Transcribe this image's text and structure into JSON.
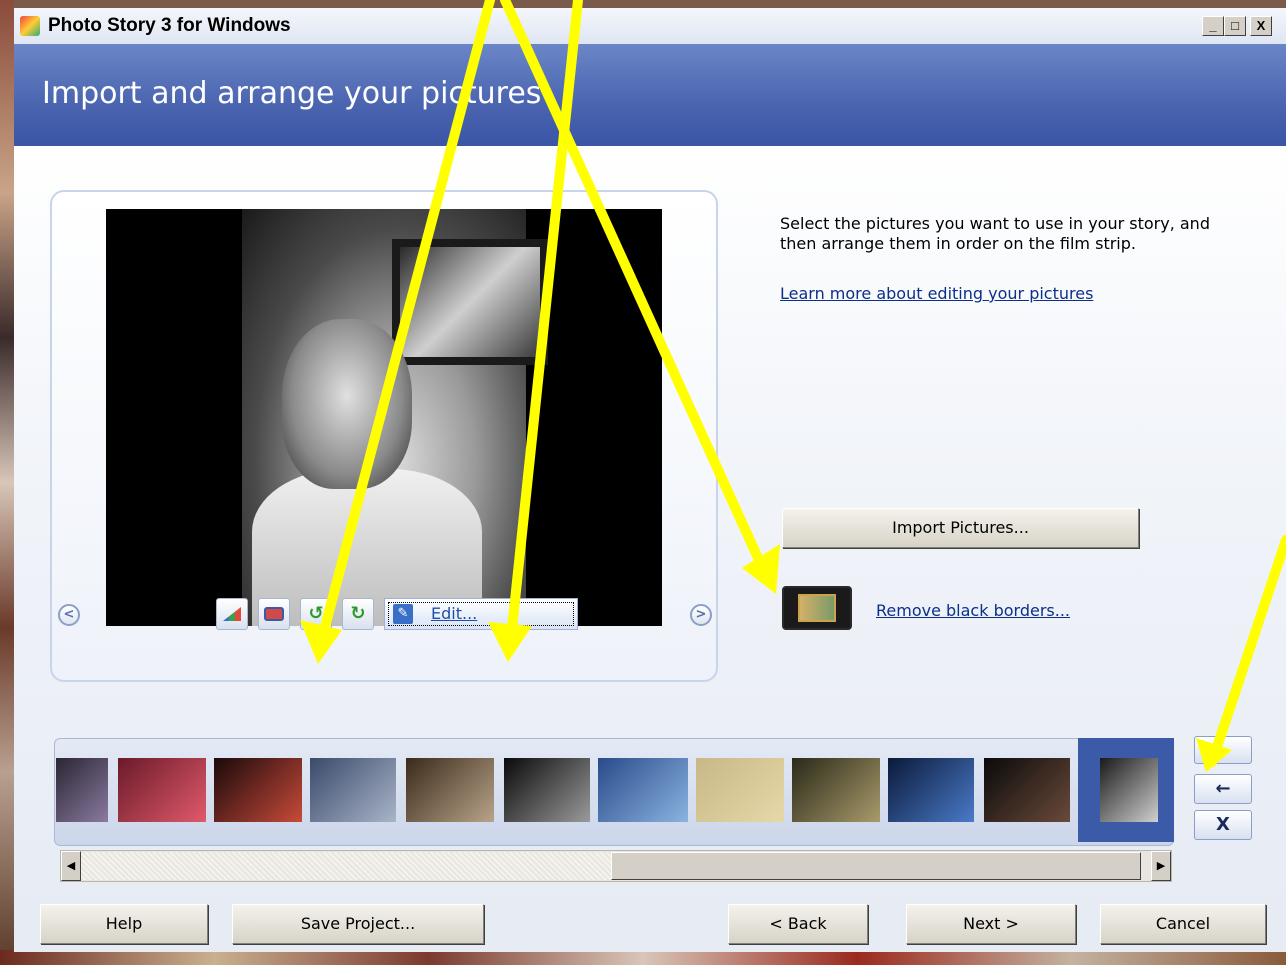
{
  "window": {
    "title": "Photo Story 3 for Windows",
    "min_label": "_",
    "max_label": "□",
    "close_label": "X"
  },
  "header": {
    "title": "Import and arrange your pictures"
  },
  "preview": {
    "prev_label": "<",
    "next_label": ">",
    "tools": {
      "auto_correct_icon": "levels-icon",
      "red_eye_icon": "red-eye-icon",
      "rotate_left_icon": "rotate-left-icon",
      "rotate_right_icon": "rotate-right-icon"
    },
    "edit_label": "Edit..."
  },
  "instructions": {
    "text": "Select the pictures you want to use in your story, and then arrange them in order on the film strip.",
    "learn_link": "Learn more about editing your pictures"
  },
  "actions": {
    "import_label": "Import Pictures...",
    "remove_borders_label": "Remove black borders..."
  },
  "filmstrip": {
    "thumbnails": [
      {
        "colors": [
          "#2a2633",
          "#8a7aa0"
        ]
      },
      {
        "colors": [
          "#6a1a2a",
          "#e05a6a"
        ]
      },
      {
        "colors": [
          "#1a0a0a",
          "#c84a3a"
        ]
      },
      {
        "colors": [
          "#3a4a6a",
          "#a8b4c8"
        ]
      },
      {
        "colors": [
          "#3a2a1a",
          "#b8a48a"
        ]
      },
      {
        "colors": [
          "#0a0a0a",
          "#9a9a9a"
        ]
      },
      {
        "colors": [
          "#2a4a8a",
          "#8ab4e0"
        ]
      },
      {
        "colors": [
          "#c8b888",
          "#e6d8a8"
        ]
      },
      {
        "colors": [
          "#2a2a1a",
          "#a89a6a"
        ]
      },
      {
        "colors": [
          "#0a1a3a",
          "#4a7ac8"
        ]
      },
      {
        "colors": [
          "#0a0a0a",
          "#6a4a3a"
        ]
      },
      {
        "colors": [
          "#1a1a1a",
          "#d0d0d0"
        ]
      }
    ],
    "move_left_label": "←",
    "delete_label": "X"
  },
  "scrollbar": {
    "left_label": "◀",
    "right_label": "▶"
  },
  "footer": {
    "help_label": "Help",
    "save_label": "Save Project...",
    "back_label": "< Back",
    "next_label": "Next >",
    "cancel_label": "Cancel"
  },
  "colors": {
    "header": "#4a64b0",
    "annotation_arrows": "#ffff00",
    "selected_thumb": "#3b5aa8"
  }
}
